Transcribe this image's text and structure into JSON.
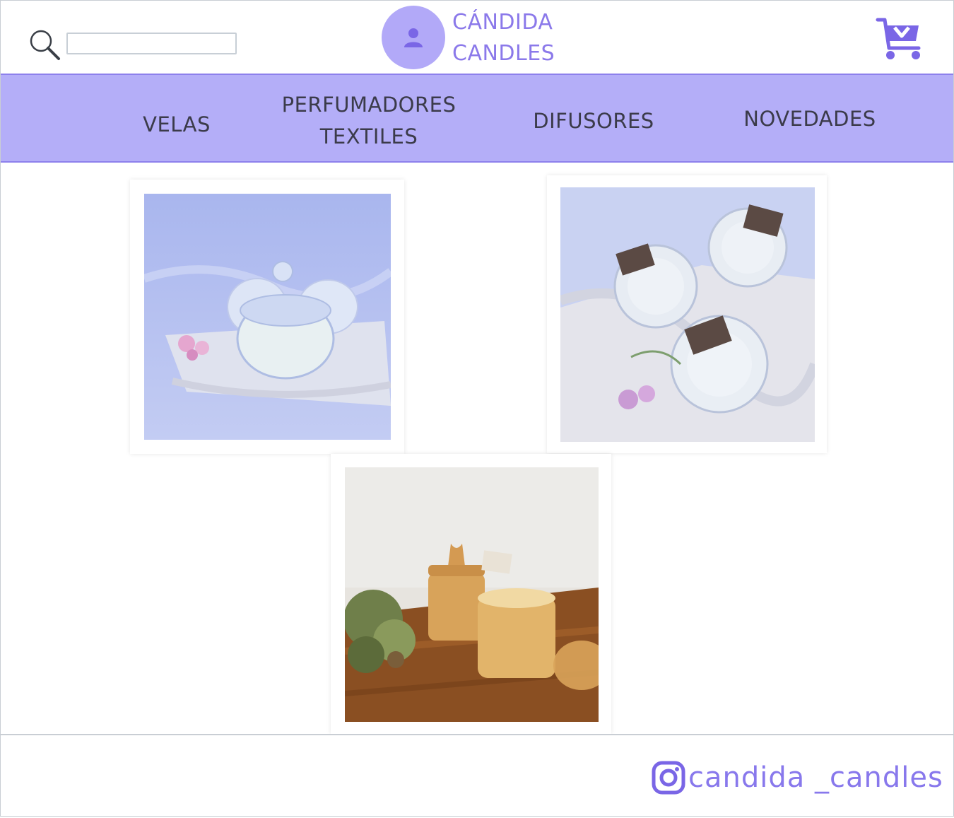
{
  "header": {
    "brand_line1": "CÁNDIDA",
    "brand_line2": "CANDLES",
    "search": {
      "value": "",
      "placeholder": ""
    }
  },
  "nav": {
    "items": [
      {
        "line1": "VELAS",
        "line2": ""
      },
      {
        "line1": "PERFUMADORES",
        "line2": "TEXTILES"
      },
      {
        "line1": "DIFUSORES",
        "line2": ""
      },
      {
        "line1": "NOVEDADES",
        "line2": ""
      }
    ]
  },
  "footer": {
    "instagram_handle": "candida _candles"
  },
  "colors": {
    "accent": "#8b79ea",
    "nav_background": "#b4aef8",
    "avatar": "#b2a9f8"
  },
  "icons": [
    "search-icon",
    "user-icon",
    "cart-icon",
    "instagram-icon"
  ]
}
